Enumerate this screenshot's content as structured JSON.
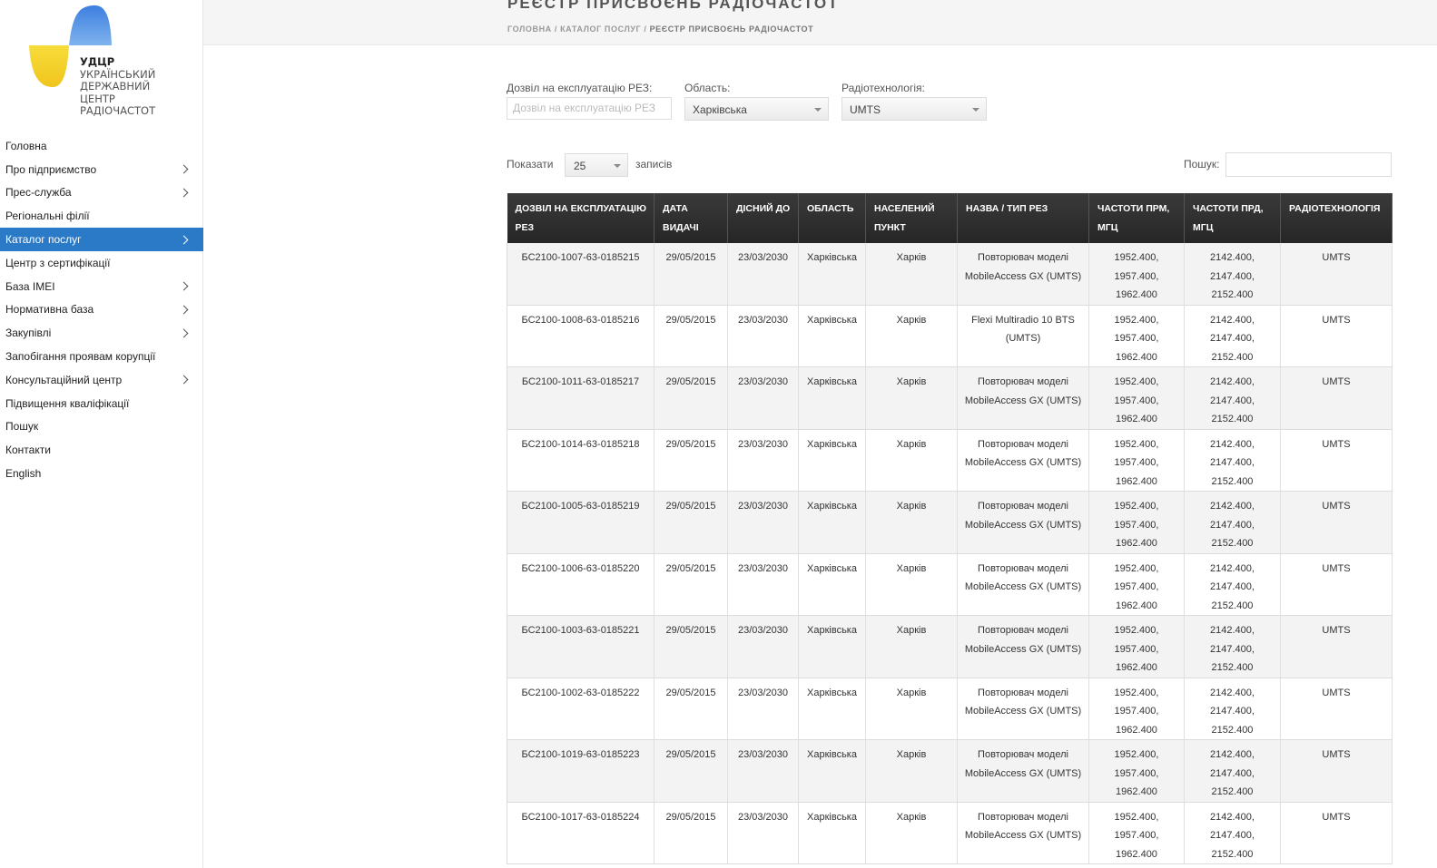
{
  "logo": {
    "abbr": "УДЦР",
    "line1": "УКРАЇНСЬКИЙ",
    "line2": "ДЕРЖАВНИЙ",
    "line3": "ЦЕНТР",
    "line4": "РАДІОЧАСТОТ",
    "colors": {
      "blue": "#4a8fe0",
      "yellow": "#f2d02a"
    }
  },
  "sidebar": {
    "items": [
      {
        "label": "Головна",
        "has_children": false
      },
      {
        "label": "Про підприємство",
        "has_children": true
      },
      {
        "label": "Прес-служба",
        "has_children": true
      },
      {
        "label": "Регіональні філії",
        "has_children": false
      },
      {
        "label": "Каталог послуг",
        "has_children": true,
        "active": true
      },
      {
        "label": "Центр з сертифікації",
        "has_children": false
      },
      {
        "label": "База IMEI",
        "has_children": true
      },
      {
        "label": "Нормативна база",
        "has_children": true
      },
      {
        "label": "Закупівлі",
        "has_children": true
      },
      {
        "label": "Запобігання проявам корупції",
        "has_children": false
      },
      {
        "label": "Консультаційний центр",
        "has_children": true
      },
      {
        "label": "Підвищення кваліфікації",
        "has_children": false
      },
      {
        "label": "Пошук",
        "has_children": false
      },
      {
        "label": "Контакти",
        "has_children": false
      },
      {
        "label": "English",
        "has_children": false
      }
    ],
    "active_color": "#2a7ac7"
  },
  "header": {
    "title": "РЕЄСТР ПРИСВОЄНЬ РАДІОЧАСТОТ",
    "breadcrumb": {
      "home": "ГОЛОВНА",
      "sep": " / ",
      "catalog": "КАТАЛОГ ПОСЛУГ",
      "current": "РЕЄСТР ПРИСВОЄНЬ РАДІОЧАСТОТ"
    }
  },
  "filters": {
    "permit_label": "Дозвіл на експлуатацію РЕЗ:",
    "permit_placeholder": "Дозвіл на експлуатацію РЕЗ",
    "region_label": "Область:",
    "region_value": "Харківська",
    "tech_label": "Радіотехнологія:",
    "tech_value": "UMTS"
  },
  "table_controls": {
    "show_label": "Показати",
    "page_size": "25",
    "records_label": "записів",
    "search_label": "Пошук:"
  },
  "table": {
    "columns": [
      "ДОЗВІЛ НА ЕКСПЛУАТАЦІЮ РЕЗ",
      "ДАТА ВИДАЧІ",
      "ДІСНИЙ ДО",
      "ОБЛАСТЬ",
      "НАСЕЛЕНИЙ ПУНКТ",
      "НАЗВА / ТИП РЕЗ",
      "ЧАСТОТИ ПРМ, МГЦ",
      "ЧАСТОТИ ПРД, МГЦ",
      "РАДІОТЕХНОЛОГІЯ"
    ],
    "rows": [
      [
        "БС2100-1007-63-0185215",
        "29/05/2015",
        "23/03/2030",
        "Харківська",
        "Харків",
        "Повторювач моделі MobileAccess GX (UMTS)",
        "1952.400, 1957.400, 1962.400",
        "2142.400, 2147.400, 2152.400",
        "UMTS"
      ],
      [
        "БС2100-1008-63-0185216",
        "29/05/2015",
        "23/03/2030",
        "Харківська",
        "Харків",
        "Flexi Multiradio 10 BTS (UMTS)",
        "1952.400, 1957.400, 1962.400",
        "2142.400, 2147.400, 2152.400",
        "UMTS"
      ],
      [
        "БС2100-1011-63-0185217",
        "29/05/2015",
        "23/03/2030",
        "Харківська",
        "Харків",
        "Повторювач моделі MobileAccess GX (UMTS)",
        "1952.400, 1957.400, 1962.400",
        "2142.400, 2147.400, 2152.400",
        "UMTS"
      ],
      [
        "БС2100-1014-63-0185218",
        "29/05/2015",
        "23/03/2030",
        "Харківська",
        "Харків",
        "Повторювач моделі MobileAccess GX (UMTS)",
        "1952.400, 1957.400, 1962.400",
        "2142.400, 2147.400, 2152.400",
        "UMTS"
      ],
      [
        "БС2100-1005-63-0185219",
        "29/05/2015",
        "23/03/2030",
        "Харківська",
        "Харків",
        "Повторювач моделі MobileAccess GX (UMTS)",
        "1952.400, 1957.400, 1962.400",
        "2142.400, 2147.400, 2152.400",
        "UMTS"
      ],
      [
        "БС2100-1006-63-0185220",
        "29/05/2015",
        "23/03/2030",
        "Харківська",
        "Харків",
        "Повторювач моделі MobileAccess GX (UMTS)",
        "1952.400, 1957.400, 1962.400",
        "2142.400, 2147.400, 2152.400",
        "UMTS"
      ],
      [
        "БС2100-1003-63-0185221",
        "29/05/2015",
        "23/03/2030",
        "Харківська",
        "Харків",
        "Повторювач моделі MobileAccess GX (UMTS)",
        "1952.400, 1957.400, 1962.400",
        "2142.400, 2147.400, 2152.400",
        "UMTS"
      ],
      [
        "БС2100-1002-63-0185222",
        "29/05/2015",
        "23/03/2030",
        "Харківська",
        "Харків",
        "Повторювач моделі MobileAccess GX (UMTS)",
        "1952.400, 1957.400, 1962.400",
        "2142.400, 2147.400, 2152.400",
        "UMTS"
      ],
      [
        "БС2100-1019-63-0185223",
        "29/05/2015",
        "23/03/2030",
        "Харківська",
        "Харків",
        "Повторювач моделі MobileAccess GX (UMTS)",
        "1952.400, 1957.400, 1962.400",
        "2142.400, 2147.400, 2152.400",
        "UMTS"
      ],
      [
        "БС2100-1017-63-0185224",
        "29/05/2015",
        "23/03/2030",
        "Харківська",
        "Харків",
        "Повторювач моделі MobileAccess GX (UMTS)",
        "1952.400, 1957.400, 1962.400",
        "2142.400, 2147.400, 2152.400",
        "UMTS"
      ]
    ]
  }
}
